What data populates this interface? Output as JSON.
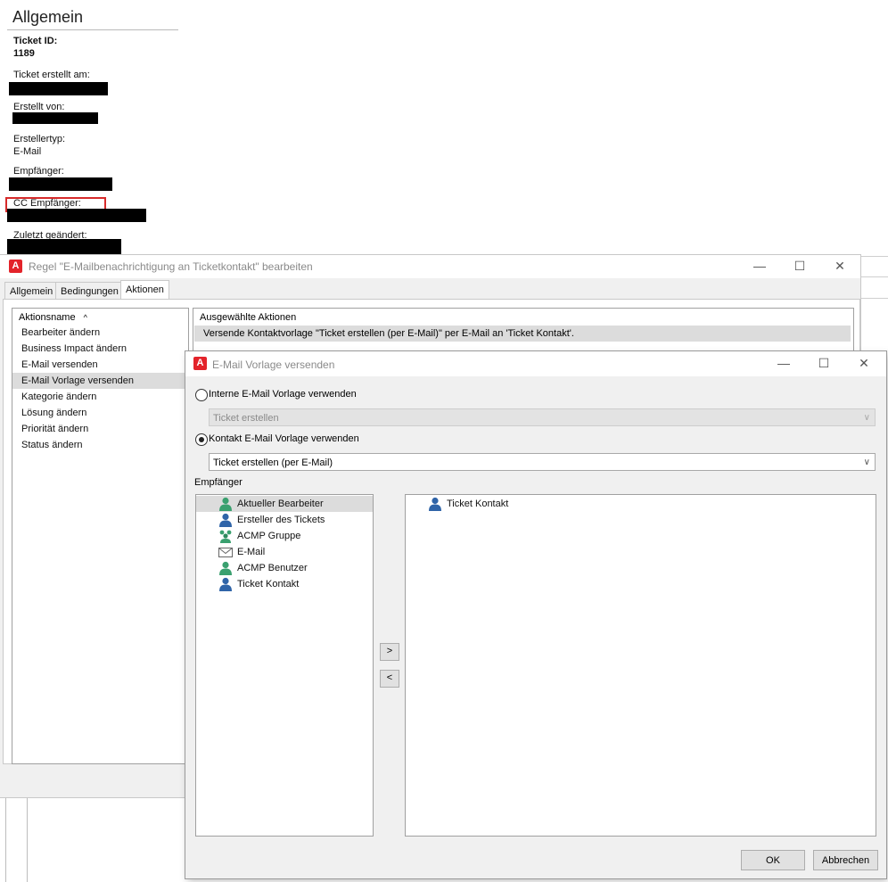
{
  "ticket_panel": {
    "title": "Allgemein",
    "ticket_id_label": "Ticket ID:",
    "ticket_id_value": "1189",
    "created_label": "Ticket erstellt am:",
    "created_by_label": "Erstellt von:",
    "creator_type_label": "Erstellertyp:",
    "creator_type_value": "E-Mail",
    "recipient_label": "Empfänger:",
    "cc_label": "CC Empfänger:",
    "last_changed_label": "Zuletzt geändert:"
  },
  "rule_window": {
    "title": "Regel \"E-Mailbenachrichtigung an Ticketkontakt\" bearbeiten",
    "window_controls": {
      "minimize": "—",
      "maximize": "☐",
      "close": "✕"
    },
    "tabs": [
      {
        "label": "Allgemein",
        "active": false
      },
      {
        "label": "Bedingungen",
        "active": false
      },
      {
        "label": "Aktionen",
        "active": true
      }
    ],
    "actions_header": "Aktionsname",
    "sort_glyph": "^",
    "actions": [
      {
        "label": "Bearbeiter ändern"
      },
      {
        "label": "Business Impact ändern"
      },
      {
        "label": "E-Mail versenden"
      },
      {
        "label": "E-Mail Vorlage versenden",
        "selected": true
      },
      {
        "label": "Kategorie ändern"
      },
      {
        "label": "Lösung ändern"
      },
      {
        "label": "Priorität ändern"
      },
      {
        "label": "Status ändern"
      }
    ],
    "selected_actions_header": "Ausgewählte Aktionen",
    "selected_action_row": "Versende Kontaktvorlage \"Ticket erstellen (per E-Mail)\" per E-Mail an 'Ticket Kontakt'."
  },
  "mail_dialog": {
    "title": "E-Mail Vorlage versenden",
    "window_controls": {
      "minimize": "—",
      "maximize": "☐",
      "close": "✕"
    },
    "option_internal": "Interne E-Mail Vorlage verwenden",
    "internal_selected": "Ticket erstellen",
    "option_contact": "Kontakt E-Mail Vorlage verwenden",
    "contact_selected": "Ticket erstellen (per E-Mail)",
    "recipients_label": "Empfänger",
    "available_recipients": [
      {
        "label": "Aktueller Bearbeiter",
        "icon": "user-green-icon",
        "selected": true
      },
      {
        "label": "Ersteller des Tickets",
        "icon": "user-blue-icon"
      },
      {
        "label": "ACMP Gruppe",
        "icon": "user-group-icon"
      },
      {
        "label": "E-Mail",
        "icon": "envelope-icon"
      },
      {
        "label": "ACMP Benutzer",
        "icon": "user-green-icon"
      },
      {
        "label": "Ticket Kontakt",
        "icon": "user-blue-icon"
      }
    ],
    "chosen_recipients": [
      {
        "label": "Ticket Kontakt",
        "icon": "user-blue-icon"
      }
    ],
    "add_label": ">",
    "remove_label": "<",
    "ok_label": "OK",
    "cancel_label": "Abbrechen"
  },
  "colors": {
    "accent_red": "#e3232a",
    "user_green": "#3aa06f",
    "user_blue": "#2f64a8",
    "selection": "#dcdcdc"
  }
}
